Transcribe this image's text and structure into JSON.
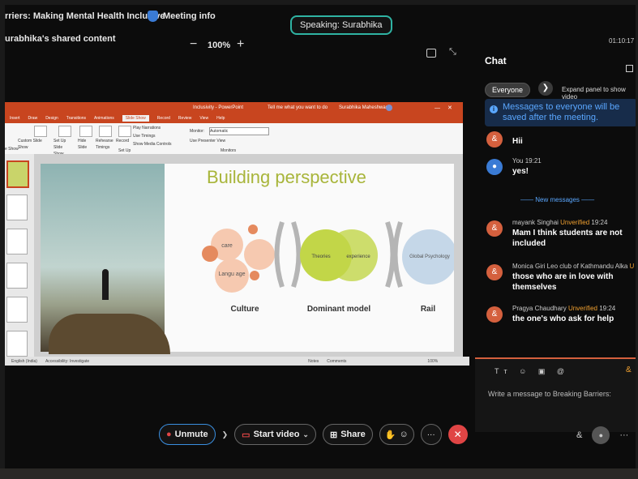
{
  "meeting": {
    "title": "rriers: Making Mental Health Inclusive",
    "info_label": "Meeting info",
    "speaking": "Speaking: Surabhika",
    "shared_content": "urabhika's shared content",
    "zoom_minus": "−",
    "zoom_level": "100%",
    "zoom_plus": "+",
    "timer": "01:10:17"
  },
  "ppt": {
    "window_title": "Inclusivity - PowerPoint",
    "user": "Surabhika Maheshwari",
    "tell_me": "Tell me what you want to do",
    "tabs": [
      "Insert",
      "Draw",
      "Design",
      "Transitions",
      "Animations",
      "Slide Show",
      "Record",
      "Review",
      "View",
      "Help"
    ],
    "active_tab": "Slide Show",
    "ribbon": {
      "custom_show": "Custom Slide Show",
      "setup": "Set Up Slide Show",
      "hide": "Hide Slide",
      "rehearse": "Rehearse Timings",
      "record": "Record",
      "play_narrations": "Play Narrations",
      "use_timings": "Use Timings",
      "show_media": "Show Media Controls",
      "setup_group": "Set Up",
      "monitor_label": "Monitor:",
      "monitor_value": "Automatic",
      "presenter_view": "Use Presenter View",
      "monitors_group": "Monitors",
      "show_group": "e Show"
    },
    "slide": {
      "title": "Building perspective",
      "culture_items": [
        "care",
        "Langu age"
      ],
      "culture_label": "Culture",
      "venn_left": "Theories",
      "venn_right": "experience",
      "dominant_label": "Dominant model",
      "global": "Global Psychology",
      "rail_label": "Rail"
    },
    "status": {
      "language": "English (India)",
      "accessibility": "Accessibility: Investigate",
      "notes": "Notes",
      "comments": "Comments",
      "zoom": "100%"
    }
  },
  "chat": {
    "header": "Chat",
    "recipient": "Everyone",
    "expand_label": "Expand panel to show video",
    "banner": "Messages to everyone will be saved after the meeting.",
    "messages": [
      {
        "sender": "",
        "time": "",
        "unverified": "",
        "text": "Hii"
      },
      {
        "sender": "You",
        "time": "19:21",
        "unverified": "",
        "text": "yes!"
      },
      {
        "sender": "mayank Singhai",
        "time": "19:24",
        "unverified": "Unverified",
        "text": "Mam I think students are not included"
      },
      {
        "sender": "Monica Giri Leo club of Kathmandu Alka",
        "time": "",
        "unverified": "U",
        "text": "those who are in love with themselves"
      },
      {
        "sender": "Pragya Chaudhary",
        "time": "19:24",
        "unverified": "Unverified",
        "text": "the one's who ask for help"
      }
    ],
    "new_messages": "——  New messages  ——",
    "input_placeholder": "Write a message to Breaking Barriers:"
  },
  "controls": {
    "unmute": "Unmute",
    "start_video": "Start video",
    "share": "Share",
    "more": "···",
    "leave": "✕"
  },
  "colors": {
    "accent_blue": "#3a8fe0",
    "teal": "#2fb3a3",
    "leave_red": "#e04545",
    "unverified": "#f0a030",
    "ppt_orange": "#c8451f",
    "slide_green": "#a8b53a"
  }
}
